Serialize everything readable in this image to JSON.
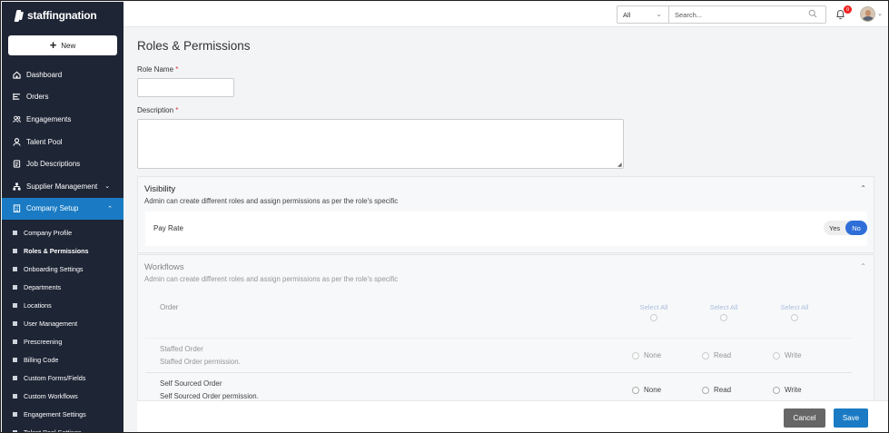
{
  "app": {
    "logo_text": "staffingnation",
    "new_button": "New"
  },
  "sidebar": {
    "items": [
      {
        "label": "Dashboard",
        "icon": "home-icon"
      },
      {
        "label": "Orders",
        "icon": "list-icon"
      },
      {
        "label": "Engagements",
        "icon": "people-icon"
      },
      {
        "label": "Talent Pool",
        "icon": "person-icon"
      },
      {
        "label": "Job Descriptions",
        "icon": "document-icon"
      },
      {
        "label": "Supplier Management",
        "icon": "org-chart-icon"
      },
      {
        "label": "Company Setup",
        "icon": "building-icon",
        "active": true
      }
    ],
    "sub_items": [
      "Company Profile",
      "Roles & Permissions",
      "Onboarding Settings",
      "Departments",
      "Locations",
      "User Management",
      "Prescreening",
      "Billing Code",
      "Custom Forms/Fields",
      "Custom Workflows",
      "Engagement Settings",
      "Talent Pool Settings"
    ],
    "current_sub": "Roles & Permissions"
  },
  "topbar": {
    "filter_value": "All",
    "search_placeholder": "Search...",
    "notification_count": "0"
  },
  "form": {
    "title": "Roles & Permissions",
    "role_name_label": "Role Name",
    "description_label": "Description",
    "required_mark": "*"
  },
  "visibility": {
    "title": "Visibility",
    "subtitle": "Admin can create different roles and assign permissions as per the role's specific",
    "pay_rate_label": "Pay Rate",
    "toggle_yes": "Yes",
    "toggle_no": "No",
    "toggle_selected": "No"
  },
  "workflows": {
    "title": "Workflows",
    "subtitle": "Admin can create different roles and assign permissions as per the role's specific",
    "column_header": "Order",
    "select_all": "Select All",
    "rows": [
      {
        "title": "Staffed Order",
        "desc": "Staffed Order permission.",
        "options": [
          "None",
          "Read",
          "Write"
        ]
      },
      {
        "title": "Self Sourced Order",
        "desc": "Self Sourced Order permission.",
        "options": [
          "None",
          "Read",
          "Write"
        ]
      }
    ]
  },
  "footer": {
    "cancel": "Cancel",
    "save": "Save"
  },
  "colors": {
    "sidebar_bg": "#1e2535",
    "accent": "#1a7bc4",
    "toggle_on": "#2f6ed8"
  }
}
